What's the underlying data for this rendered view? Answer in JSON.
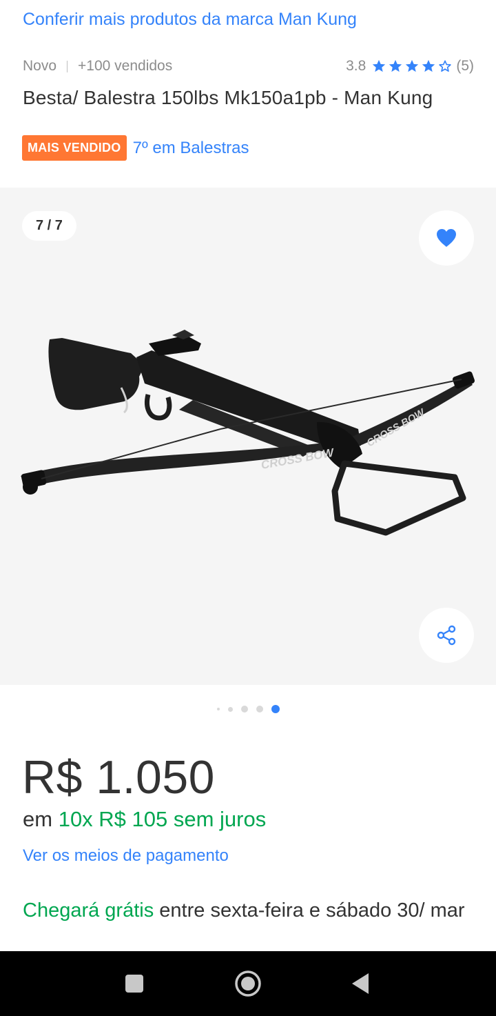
{
  "brand_link": "Conferir mais produtos da marca Man Kung",
  "meta": {
    "condition": "Novo",
    "sold": "+100 vendidos",
    "rating_value": "3.8",
    "rating_count": "(5)",
    "rating_stars": 3.8
  },
  "product_title": "Besta/ Balestra 150lbs Mk150a1pb - Man Kung",
  "badge": {
    "label": "MAIS VENDIDO",
    "rank": "7º em Balestras"
  },
  "gallery": {
    "counter": "7 / 7",
    "current_index": 7,
    "total": 7,
    "image_text": "CROSS BOW"
  },
  "price": "R$ 1.050",
  "installments": {
    "prefix": "em",
    "detail": "10x R$ 105 sem juros"
  },
  "payment_link": "Ver os meios de pagamento",
  "shipping": {
    "highlight": "Chegará grátis",
    "rest": "entre sexta-feira e sábado 30/ mar"
  },
  "colors": {
    "link_blue": "#3483fa",
    "badge_orange": "#ff7733",
    "green": "#00a650",
    "text": "#333333",
    "gallery_bg": "#f5f5f5"
  },
  "icons": {
    "favorite": "heart-icon",
    "share": "share-icon",
    "nav_recents": "square-icon",
    "nav_home": "circle-icon",
    "nav_back": "triangle-back-icon"
  }
}
